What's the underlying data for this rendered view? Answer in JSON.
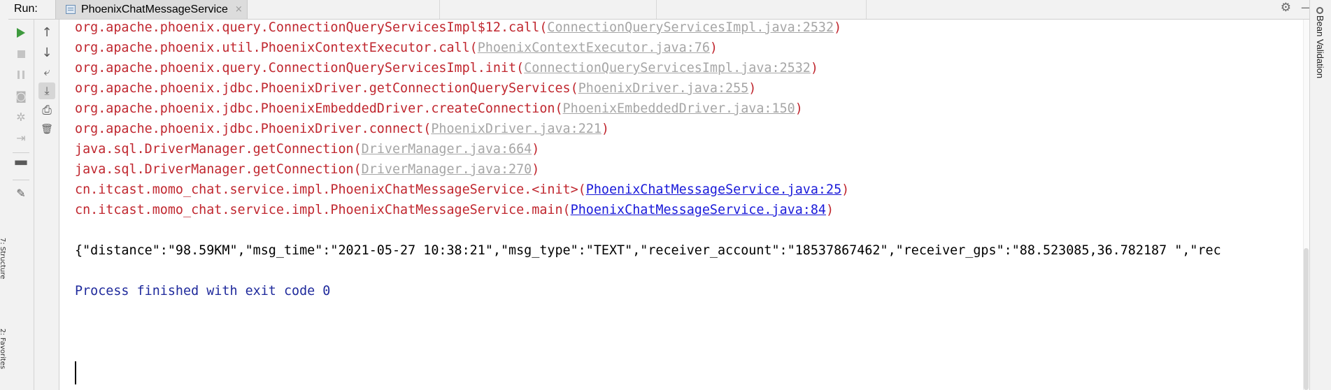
{
  "run_panel": {
    "label": "Run:",
    "tab": {
      "title": "PhoenixChatMessageService",
      "close_glyph": "×"
    }
  },
  "header_actions": {
    "settings_icon": "gear-icon",
    "minimize_icon": "minimize-icon",
    "settings_glyph": "⚙",
    "minimize_glyph": "—"
  },
  "left_side_tabs": [
    "7: Structure",
    "2: Favorites"
  ],
  "right_side_tabs": [
    "Bean Validation"
  ],
  "toolbar_left": [
    {
      "name": "rerun",
      "icon": "play-icon",
      "enabled": true
    },
    {
      "name": "stop",
      "icon": "stop-icon",
      "enabled": false
    },
    {
      "name": "pause",
      "icon": "pause-icon",
      "enabled": false
    },
    {
      "name": "dump-threads",
      "icon": "camera-icon",
      "glyph": "◙",
      "enabled": false
    },
    {
      "name": "settings",
      "icon": "debug-icon",
      "glyph": "✲",
      "enabled": false
    },
    {
      "name": "exit",
      "icon": "exit-icon",
      "glyph": "⇥",
      "enabled": false
    },
    {
      "name": "layout",
      "icon": "layout-icon",
      "glyph": "▀▀",
      "enabled": true
    },
    {
      "name": "pin",
      "icon": "pin-icon",
      "glyph": "✎",
      "enabled": true
    }
  ],
  "toolbar_right": [
    {
      "name": "up",
      "icon": "arrow-up-icon",
      "glyph": "↑",
      "active": false
    },
    {
      "name": "down",
      "icon": "arrow-down-icon",
      "glyph": "↓",
      "active": false
    },
    {
      "name": "soft-wrap",
      "icon": "soft-wrap-icon",
      "glyph": "⤶",
      "active": false
    },
    {
      "name": "scroll-to-end",
      "icon": "scroll-to-end-icon",
      "glyph": "⤓",
      "active": true
    },
    {
      "name": "print",
      "icon": "print-icon",
      "glyph": "⎙",
      "active": false
    },
    {
      "name": "clear",
      "icon": "trash-icon",
      "glyph": "🗑",
      "active": false
    }
  ],
  "console": {
    "stack_lines": [
      {
        "text": "org.apache.phoenix.query.ConnectionQueryServicesImpl$12.call(",
        "link": "ConnectionQueryServicesImpl.java:2532",
        "tail": ")",
        "link_kind": "library"
      },
      {
        "text": "org.apache.phoenix.util.PhoenixContextExecutor.call(",
        "link": "PhoenixContextExecutor.java:76",
        "tail": ")",
        "link_kind": "library"
      },
      {
        "text": "org.apache.phoenix.query.ConnectionQueryServicesImpl.init(",
        "link": "ConnectionQueryServicesImpl.java:2532",
        "tail": ")",
        "link_kind": "library"
      },
      {
        "text": "org.apache.phoenix.jdbc.PhoenixDriver.getConnectionQueryServices(",
        "link": "PhoenixDriver.java:255",
        "tail": ")",
        "link_kind": "library"
      },
      {
        "text": "org.apache.phoenix.jdbc.PhoenixEmbeddedDriver.createConnection(",
        "link": "PhoenixEmbeddedDriver.java:150",
        "tail": ")",
        "link_kind": "library"
      },
      {
        "text": "org.apache.phoenix.jdbc.PhoenixDriver.connect(",
        "link": "PhoenixDriver.java:221",
        "tail": ")",
        "link_kind": "library"
      },
      {
        "text": "java.sql.DriverManager.getConnection(",
        "link": "DriverManager.java:664",
        "tail": ")",
        "link_kind": "library"
      },
      {
        "text": "java.sql.DriverManager.getConnection(",
        "link": "DriverManager.java:270",
        "tail": ")",
        "link_kind": "library"
      },
      {
        "text": "cn.itcast.momo_chat.service.impl.PhoenixChatMessageService.<init>(",
        "link": "PhoenixChatMessageService.java:25",
        "tail": ")",
        "link_kind": "project"
      },
      {
        "text": "cn.itcast.momo_chat.service.impl.PhoenixChatMessageService.main(",
        "link": "PhoenixChatMessageService.java:84",
        "tail": ")",
        "link_kind": "project"
      }
    ],
    "json_output": "{\"distance\":\"98.59KM\",\"msg_time\":\"2021-05-27 10:38:21\",\"msg_type\":\"TEXT\",\"receiver_account\":\"18537867462\",\"receiver_gps\":\"88.523085,36.782187 \",\"rec",
    "process_message": "Process finished with exit code 0"
  },
  "colors": {
    "error_text": "#c0272f",
    "library_link": "#a6a6a6",
    "project_link": "#1a1ad9",
    "process_text": "#1f2a9c",
    "run_green": "#3e9a3e"
  }
}
